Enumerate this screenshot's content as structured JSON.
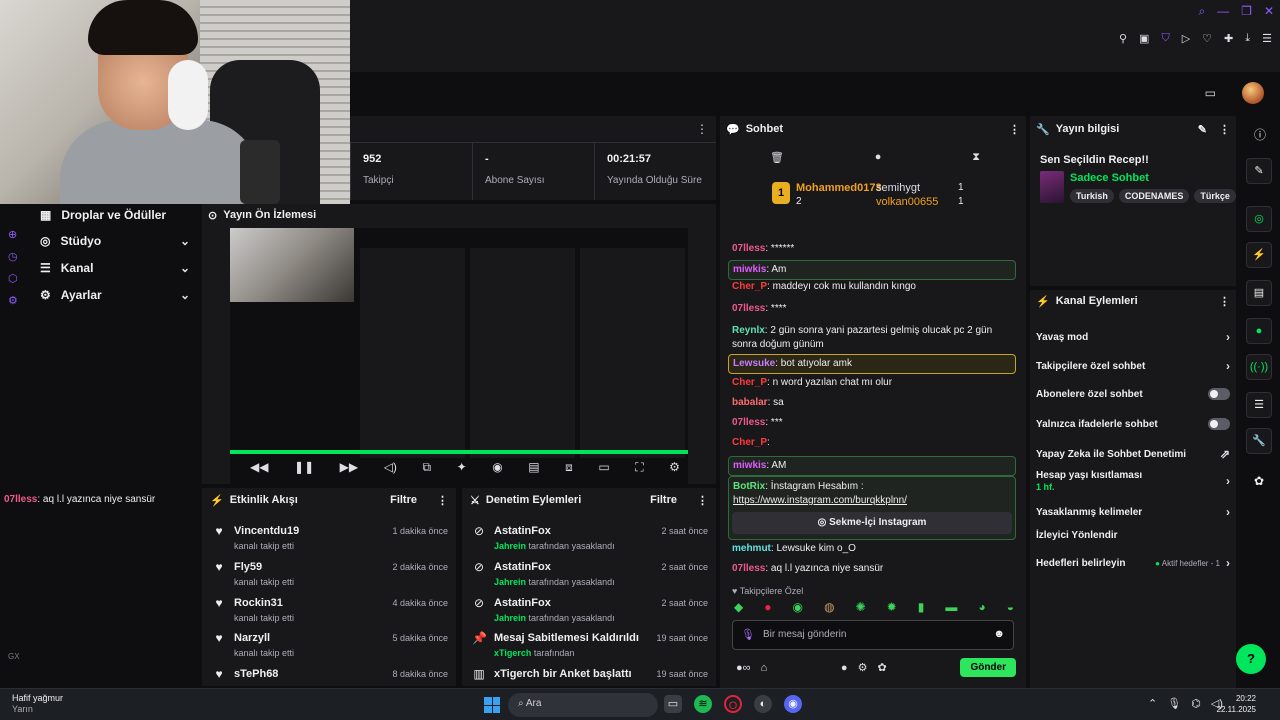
{
  "stats": {
    "followers_value": "952",
    "followers_label": "Takipçi",
    "subs_value": "-",
    "subs_label": "Abone Sayısı",
    "uptime_value": "00:21:57",
    "uptime_label": "Yayında Olduğu Süre"
  },
  "nav": [
    {
      "label": "Droplar ve Ödüller",
      "icon": "gift-icon"
    },
    {
      "label": "Stüdyo",
      "icon": "studio-icon"
    },
    {
      "label": "Kanal",
      "icon": "channel-icon"
    },
    {
      "label": "Ayarlar",
      "icon": "gear-icon"
    }
  ],
  "left_chat": {
    "user": "07lless",
    "text": ": aq l.l yazınca niye sansür"
  },
  "gx_label": "GX",
  "preview": {
    "title": "Yayın Ön İzlemesi"
  },
  "activity": {
    "title": "Etkinlik Akışı",
    "filter": "Filtre",
    "items": [
      {
        "name": "Vincentdu19",
        "action": "kanalı takip etti",
        "time": "1 dakika önce"
      },
      {
        "name": "Fly59",
        "action": "kanalı takip etti",
        "time": "2 dakika önce"
      },
      {
        "name": "Rockin31",
        "action": "kanalı takip etti",
        "time": "4 dakika önce"
      },
      {
        "name": "Narzyll",
        "action": "kanalı takip etti",
        "time": "5 dakika önce"
      },
      {
        "name": "sTePh68",
        "action": "",
        "time": "8 dakika önce"
      }
    ]
  },
  "moderation": {
    "title": "Denetim Eylemleri",
    "filter": "Filtre",
    "items": [
      {
        "name": "AstatinFox",
        "by": "Jahrein",
        "action": "tarafından yasaklandı",
        "time": "2 saat önce"
      },
      {
        "name": "AstatinFox",
        "by": "Jahrein",
        "action": "tarafından yasaklandı",
        "time": "2 saat önce"
      },
      {
        "name": "AstatinFox",
        "by": "Jahrein",
        "action": "tarafından yasaklandı",
        "time": "2 saat önce"
      },
      {
        "name": "Mesaj Sabitlemesi Kaldırıldı",
        "by": "xTigerch",
        "action": "tarafından",
        "time": "19 saat önce"
      },
      {
        "name": "xTigerch bir Anket başlattı",
        "by": "",
        "action": "",
        "time": "19 saat önce"
      }
    ]
  },
  "chat": {
    "title": "Sohbet",
    "leaderboard": {
      "rank": "1",
      "user1": "Mohammed0173",
      "count1": "2",
      "user2": "semihygt",
      "n2": "1",
      "user3": "volkan00655",
      "n3": "1"
    },
    "messages": [
      {
        "user": "07lless",
        "color": "#f05a8a",
        "text": ": ******",
        "hl": ""
      },
      {
        "user": "miwkis",
        "color": "#e05cff",
        "text": ": Am",
        "hl": "green"
      },
      {
        "user": "Cher_P",
        "color": "#ff3b3b",
        "text": ": maddeyı cok mu kullandın kıngo",
        "hl": ""
      },
      {
        "user": "07lless",
        "color": "#f05a8a",
        "text": ": ****",
        "hl": ""
      },
      {
        "user": "Reynlx",
        "color": "#5ee4b0",
        "text": ": 2 gün sonra yani pazartesi gelmiş olucak pc 2 gün sonra doğum günüm",
        "hl": ""
      },
      {
        "user": "Lewsuke",
        "color": "#c57cff",
        "text": ": bot atıyolar amk",
        "hl": "gold"
      },
      {
        "user": "Cher_P",
        "color": "#ff3b3b",
        "text": ": n word yazılan chat mı olur",
        "hl": ""
      },
      {
        "user": "babalar",
        "color": "#ff6b6b",
        "text": ": sa",
        "hl": ""
      },
      {
        "user": "07lless",
        "color": "#f05a8a",
        "text": ": ***",
        "hl": ""
      },
      {
        "user": "Cher_P",
        "color": "#ff3b3b",
        "text": ":",
        "hl": ""
      },
      {
        "user": "miwkis",
        "color": "#e05cff",
        "text": ": AM",
        "hl": "green"
      }
    ],
    "bot": {
      "user": "BotRix",
      "text": ": İnstagram Hesabım :",
      "link": "https://www.instagram.com/burqkkplnn/",
      "button": "Sekme-İçi Instagram"
    },
    "after": [
      {
        "user": "mehmut",
        "color": "#5ee4e4",
        "text": ": Lewsuke kim o_O"
      },
      {
        "user": "07lless",
        "color": "#f05a8a",
        "text": ": aq l.l yazınca niye sansür"
      }
    ],
    "subs_only": "Takipçilere Özel",
    "placeholder": "Bir mesaj gönderin",
    "send": "Gönder"
  },
  "info": {
    "title": "Yayın bilgisi",
    "stream_title": "Sen Seçildin Recep!!",
    "category": "Sadece Sohbet",
    "tags": [
      "Turkish",
      "CODENAMES",
      "Türkçe"
    ]
  },
  "actions": {
    "title": "Kanal Eylemleri",
    "items": [
      {
        "label": "Yavaş mod",
        "kind": "arrow"
      },
      {
        "label": "Takipçilere özel sohbet",
        "kind": "arrow"
      },
      {
        "label": "Abonelere özel sohbet",
        "kind": "toggle",
        "on": false
      },
      {
        "label": "Yalnızca ifadelerle sohbet",
        "kind": "toggle",
        "on": false
      },
      {
        "label": "Yapay Zeka ile Sohbet Denetimi",
        "kind": "external"
      },
      {
        "label": "Hesap yaşı kısıtlaması",
        "sub": "1 hf.",
        "kind": "arrow"
      },
      {
        "label": "Yasaklanmış kelimeler",
        "kind": "arrow"
      },
      {
        "label": "İzleyici Yönlendir",
        "kind": "none"
      },
      {
        "label": "Hedefleri belirleyin",
        "aktif": "Aktif hedefler - 1",
        "kind": "arrow"
      }
    ]
  },
  "taskbar": {
    "weather": "Hafif yağmur",
    "weather_sub": "Yarın",
    "search": "Ara",
    "time": "20:22",
    "date": "22.11.2025"
  },
  "colors": {
    "accent": "#00e65c",
    "purple": "#8f5cff",
    "panel": "#18181b",
    "bg": "#0e0e10"
  }
}
